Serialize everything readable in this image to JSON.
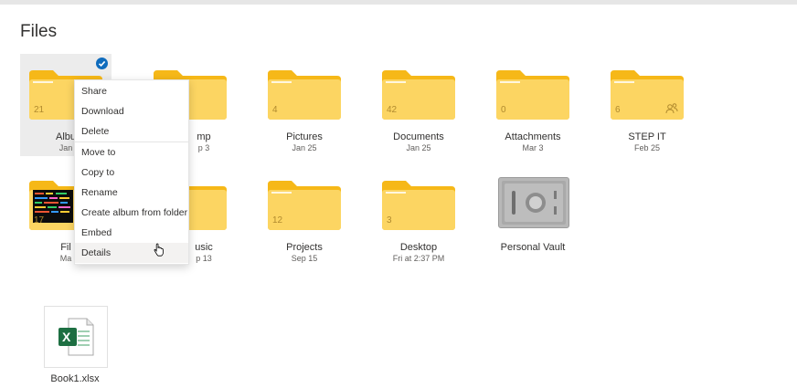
{
  "page": {
    "title": "Files"
  },
  "tiles": [
    {
      "name": "Albu",
      "date": "Jan",
      "count": "21",
      "selected": true
    },
    {
      "name": "mp",
      "date": "p 3"
    },
    {
      "name": "Pictures",
      "date": "Jan 25",
      "count": "4"
    },
    {
      "name": "Documents",
      "date": "Jan 25",
      "count": "42"
    },
    {
      "name": "Attachments",
      "date": "Mar 3",
      "count": "0"
    },
    {
      "name": "STEP IT",
      "date": "Feb 25",
      "count": "6",
      "shared": true
    },
    {
      "name": "Fil",
      "date": "Ma",
      "count": "17"
    },
    {
      "name": "usic",
      "date": "p 13"
    },
    {
      "name": "Projects",
      "date": "Sep 15",
      "count": "12"
    },
    {
      "name": "Desktop",
      "date": "Fri at 2:37 PM",
      "count": "3"
    },
    {
      "name": "Personal Vault"
    }
  ],
  "file": {
    "name": "Book1.xlsx",
    "icon_letter": "X"
  },
  "context_menu": {
    "items": [
      "Share",
      "Download",
      "Delete",
      "Move to",
      "Copy to",
      "Rename",
      "Create album from folder",
      "Embed",
      "Details"
    ],
    "hovered": "Details"
  },
  "colors": {
    "folder": "#fcd562",
    "folder_tab": "#f6b818",
    "accent": "#0f6cbd",
    "excel": "#1d6f42"
  },
  "icons": [
    "check-icon",
    "folder-icon",
    "shared-people-icon",
    "vault-icon",
    "excel-file-icon",
    "hand-cursor-icon"
  ]
}
